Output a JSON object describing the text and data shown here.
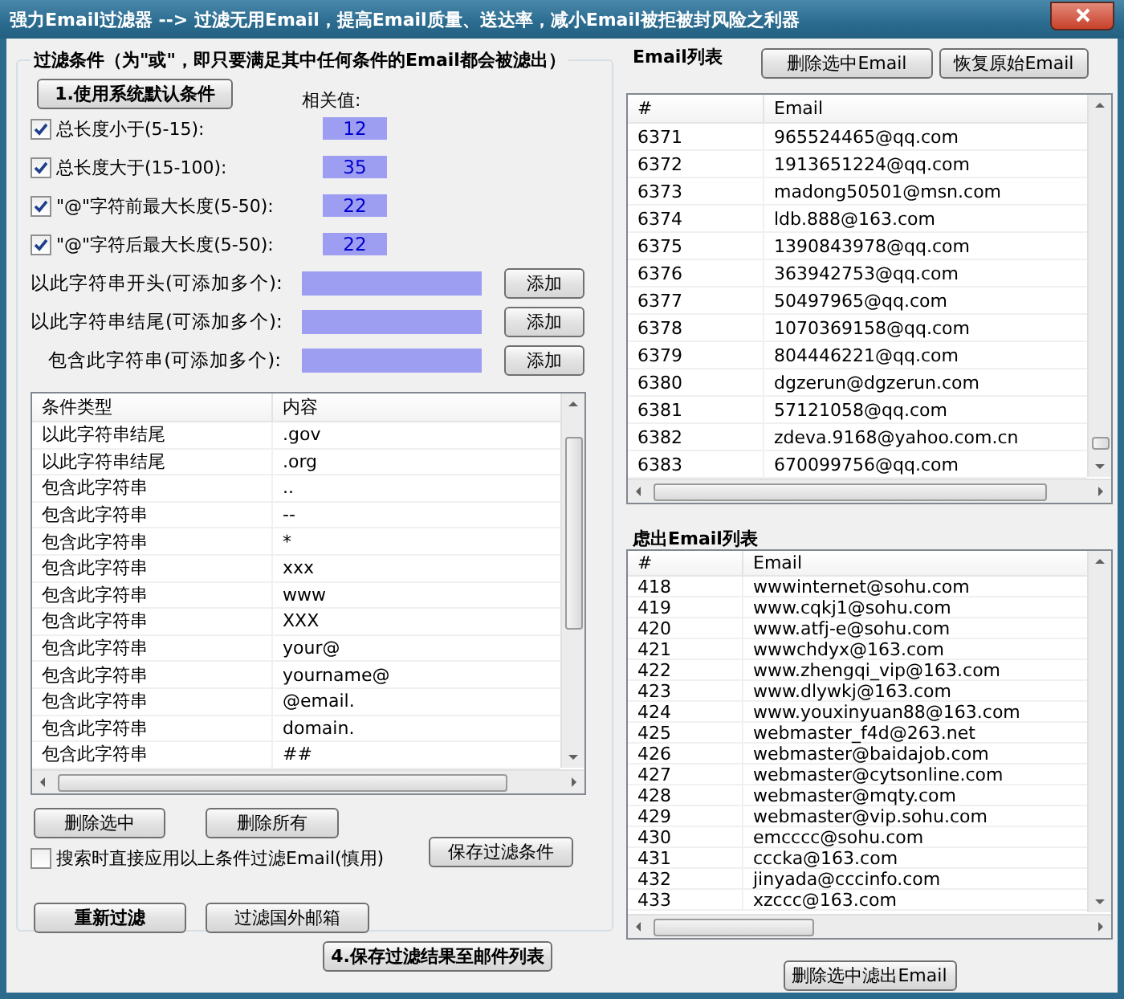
{
  "window": {
    "title": "强力Email过滤器 --> 过滤无用Email，提高Email质量、送达率，减小Email被拒被封风险之利器"
  },
  "filter_panel": {
    "title": "过滤条件（为\"或\"，即只要满足其中任何条件的Email都会被滤出）",
    "default_button": "1.使用系统默认条件",
    "value_header": "相关值:",
    "conditions": [
      {
        "label": "总长度小于(5-15):",
        "checked": true,
        "value": "12"
      },
      {
        "label": "总长度大于(15-100):",
        "checked": true,
        "value": "35"
      },
      {
        "label": "\"@\"字符前最大长度(5-50):",
        "checked": true,
        "value": "22"
      },
      {
        "label": "\"@\"字符后最大长度(5-50):",
        "checked": true,
        "value": "22"
      }
    ],
    "string_rules": [
      {
        "label": "以此字符串开头(可添加多个):",
        "button": "添加"
      },
      {
        "label": "以此字符串结尾(可添加多个):",
        "button": "添加"
      },
      {
        "label": "包含此字符串(可添加多个):",
        "button": "添加"
      }
    ],
    "rule_table": {
      "columns": [
        "条件类型",
        "内容"
      ],
      "rows": [
        [
          "以此字符串结尾",
          ".gov"
        ],
        [
          "以此字符串结尾",
          ".org"
        ],
        [
          "包含此字符串",
          ".."
        ],
        [
          "包含此字符串",
          "--"
        ],
        [
          "包含此字符串",
          "*"
        ],
        [
          "包含此字符串",
          "xxx"
        ],
        [
          "包含此字符串",
          "www"
        ],
        [
          "包含此字符串",
          "XXX"
        ],
        [
          "包含此字符串",
          "your@"
        ],
        [
          "包含此字符串",
          "yourname@"
        ],
        [
          "包含此字符串",
          "@email."
        ],
        [
          "包含此字符串",
          "domain."
        ],
        [
          "包含此字符串",
          "##"
        ]
      ]
    },
    "delete_selected_button": "删除选中",
    "delete_all_button": "删除所有",
    "apply_on_search": {
      "label": "搜索时直接应用以上条件过滤Email(慎用)",
      "checked": false
    },
    "save_button": "保存过滤条件",
    "refilter_button": "重新过滤",
    "foreign_button": "过滤国外邮箱"
  },
  "save_results_button": "4.保存过滤结果至邮件列表",
  "email_list": {
    "title": "Email列表",
    "buttons": [
      "删除选中Email",
      "恢复原始Email"
    ],
    "columns": [
      "#",
      "Email"
    ],
    "rows": [
      [
        "6371",
        "965524465@qq.com"
      ],
      [
        "6372",
        "1913651224@qq.com"
      ],
      [
        "6373",
        "madong50501@msn.com"
      ],
      [
        "6374",
        "ldb.888@163.com"
      ],
      [
        "6375",
        "1390843978@qq.com"
      ],
      [
        "6376",
        "363942753@qq.com"
      ],
      [
        "6377",
        "50497965@qq.com"
      ],
      [
        "6378",
        "1070369158@qq.com"
      ],
      [
        "6379",
        "804446221@qq.com"
      ],
      [
        "6380",
        "dgzerun@dgzerun.com"
      ],
      [
        "6381",
        "57121058@qq.com"
      ],
      [
        "6382",
        "zdeva.9168@yahoo.com.cn"
      ],
      [
        "6383",
        "670099756@qq.com"
      ]
    ]
  },
  "filtered_list": {
    "title": "虑出Email列表",
    "columns": [
      "#",
      "Email"
    ],
    "rows": [
      [
        "418",
        "wwwinternet@sohu.com"
      ],
      [
        "419",
        "www.cqkj1@sohu.com"
      ],
      [
        "420",
        "www.atfj-e@sohu.com"
      ],
      [
        "421",
        "wwwchdyx@163.com"
      ],
      [
        "422",
        "www.zhengqi_vip@163.com"
      ],
      [
        "423",
        "www.dlywkj@163.com"
      ],
      [
        "424",
        "www.youxinyuan88@163.com"
      ],
      [
        "425",
        "webmaster_f4d@263.net"
      ],
      [
        "426",
        "webmaster@baidajob.com"
      ],
      [
        "427",
        "webmaster@cytsonline.com"
      ],
      [
        "428",
        "webmaster@mqty.com"
      ],
      [
        "429",
        "webmaster@vip.sohu.com"
      ],
      [
        "430",
        "emcccc@sohu.com"
      ],
      [
        "431",
        "cccka@163.com"
      ],
      [
        "432",
        "jinyada@cccinfo.com"
      ],
      [
        "433",
        "xzccc@163.com"
      ]
    ],
    "buttons": [
      "删除选中滤出Email"
    ]
  }
}
